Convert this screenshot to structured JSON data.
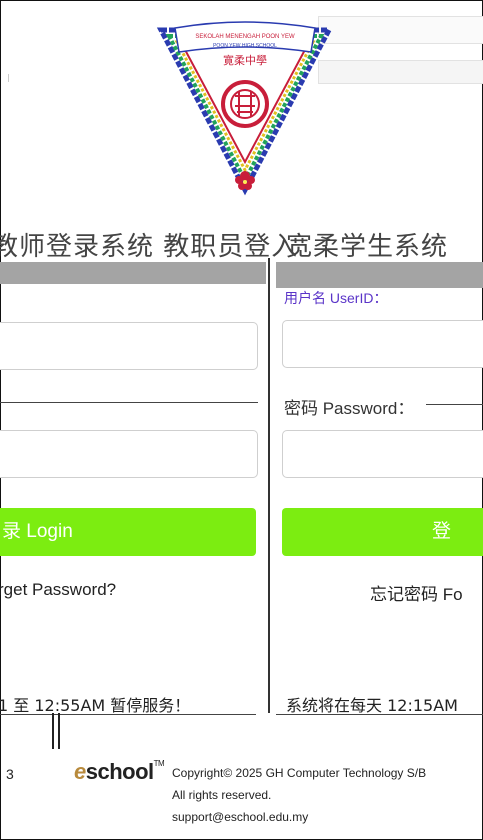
{
  "school": {
    "name_my": "SEKOLAH MENENGAH POON YEW",
    "name_en": "POON YEW HIGH SCHOOL",
    "name_cn": "寛柔中學"
  },
  "banner": {
    "left_text": "教师登录系统 教职员登入",
    "right_text": "宽柔学生系统"
  },
  "left_panel": {
    "password_line": "",
    "login_label": "录 Login",
    "forgot_label": "rget Password?",
    "notice": "1 至 12:55AM 暂停服务！"
  },
  "right_panel": {
    "username_label": "用户名 UserID：",
    "password_label": "密码 Password：",
    "login_label": "登",
    "forgot_label": "忘记密码 Fo",
    "notice": "系统将在每天 12:15AM"
  },
  "footer": {
    "left_text": "3",
    "brand": "school",
    "brand_e": "e",
    "tm": "TM",
    "copyright": "Copyright© 2025 GH Computer Technology S/B",
    "rights": "All rights reserved.",
    "email": "support@eschool.edu.my"
  },
  "colors": {
    "login_button": "#7ced11",
    "panel_header": "#a4a4a4",
    "logo_blue": "#2a3bb0",
    "logo_red": "#c81e3a",
    "logo_green": "#21a35a"
  }
}
